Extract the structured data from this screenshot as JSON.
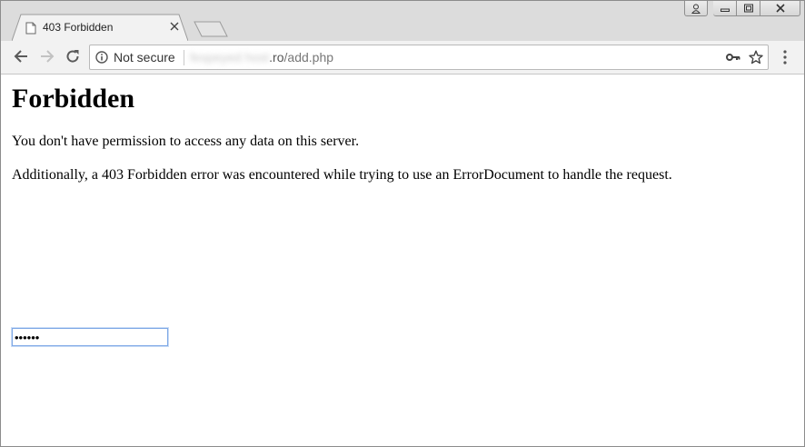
{
  "tab": {
    "title": "403 Forbidden"
  },
  "omnibox": {
    "security_label": "Not secure",
    "url_host_blurred": "fespeyed host",
    "url_tld": ".ro",
    "url_path": "/add.php"
  },
  "page": {
    "heading": "Forbidden",
    "paragraph1": "You don't have permission to access any data on this server.",
    "paragraph2": "Additionally, a 403 Forbidden error was encountered while trying to use an ErrorDocument to handle the request."
  },
  "password_field": {
    "value": "••••••"
  },
  "icons": [
    "page-icon",
    "tab-close-icon",
    "new-tab-icon",
    "user-icon",
    "minimize-icon",
    "maximize-icon",
    "window-close-icon",
    "back-arrow-icon",
    "forward-arrow-icon",
    "reload-icon",
    "info-icon",
    "key-icon",
    "star-icon",
    "menu-icon"
  ],
  "colors": {
    "titlebar": "#dcdcdc",
    "toolbar": "#f2f2f2",
    "focus_ring": "#7ea8e6"
  }
}
